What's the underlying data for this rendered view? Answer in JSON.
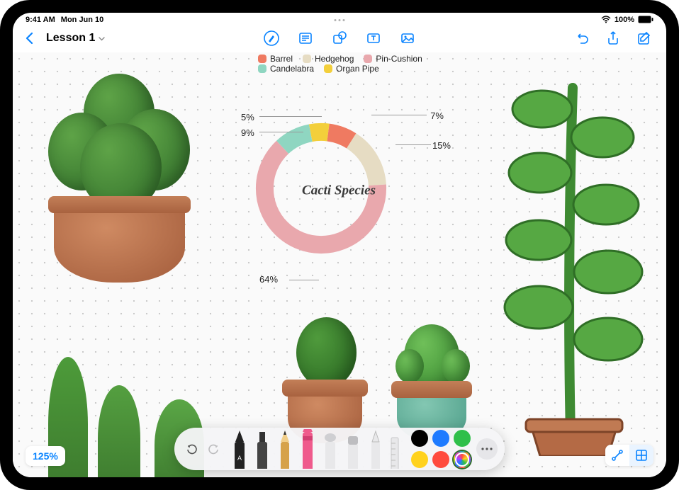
{
  "status": {
    "time": "9:41 AM",
    "date": "Mon Jun 10",
    "battery": "100%"
  },
  "header": {
    "back": "",
    "title": "Lesson 1"
  },
  "toolbar_icons": {
    "pen_circle": "pen",
    "note": "sticky",
    "shape": "shape",
    "text": "textbox",
    "media": "media",
    "undo": "undo",
    "share": "share",
    "compose": "compose",
    "connect": "connect",
    "grid": "grid"
  },
  "zoom": "125%",
  "chart_data": {
    "type": "pie",
    "title": "Cacti Species",
    "series": [
      {
        "name": "Barrel",
        "value": 7,
        "color": "#ef7a61"
      },
      {
        "name": "Hedgehog",
        "value": 15,
        "color": "#e6dcc3"
      },
      {
        "name": "Pin-Cushion",
        "value": 64,
        "color": "#e9a8ad"
      },
      {
        "name": "Candelabra",
        "value": 9,
        "color": "#8fd6c1"
      },
      {
        "name": "Organ Pipe",
        "value": 5,
        "color": "#f3cf3b"
      }
    ],
    "labels": {
      "barrel": "7%",
      "hedgehog": "15%",
      "pincushion": "64%",
      "candelabra": "9%",
      "organpipe": "5%"
    }
  },
  "legend_rows": [
    [
      "Barrel",
      "Hedgehog",
      "Pin-Cushion"
    ],
    [
      "Candelabra",
      "Organ Pipe"
    ]
  ],
  "palette": {
    "colors": [
      "#000000",
      "#1e7bff",
      "#2fbf4a",
      "#ffd21e",
      "#ff4b3e",
      "#ff4b3e"
    ],
    "selected_color": 5
  }
}
